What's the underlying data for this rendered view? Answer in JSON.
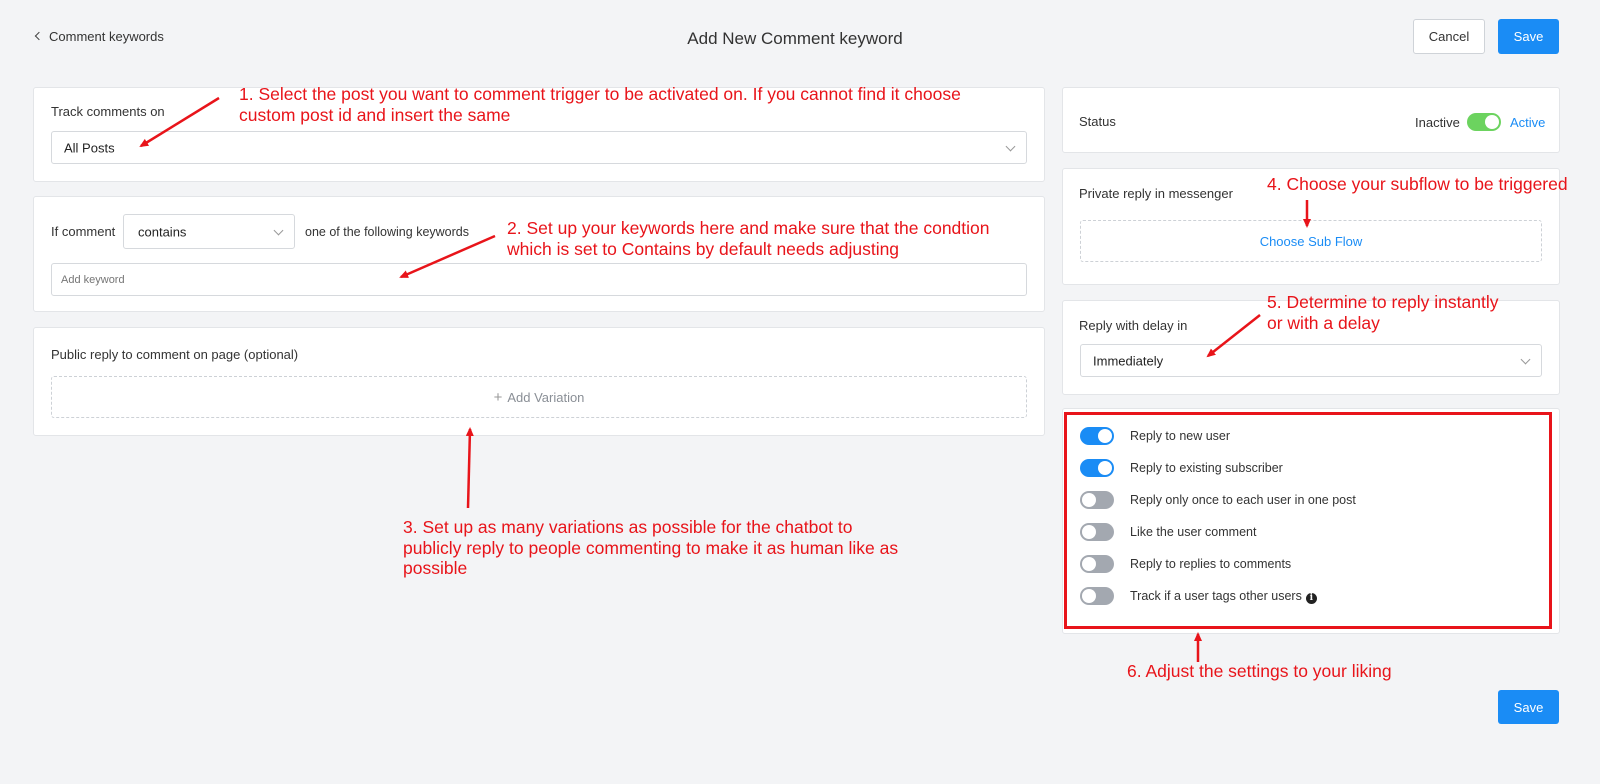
{
  "header": {
    "back_label": "Comment keywords",
    "title": "Add New Comment keyword",
    "cancel_label": "Cancel",
    "save_label": "Save"
  },
  "track": {
    "label": "Track comments on",
    "selected": "All Posts"
  },
  "keywords": {
    "if_label": "If comment",
    "condition": "contains",
    "suffix_label": "one of the following keywords",
    "placeholder": "Add keyword"
  },
  "public_reply": {
    "label": "Public reply to comment on page (optional)",
    "add_label": "Add Variation"
  },
  "status": {
    "label": "Status",
    "inactive_label": "Inactive",
    "active_label": "Active",
    "active": true
  },
  "private_reply": {
    "label": "Private reply in messenger",
    "choose_label": "Choose Sub Flow"
  },
  "delay": {
    "label": "Reply with delay in",
    "selected": "Immediately"
  },
  "options": [
    {
      "label": "Reply to new user",
      "on": true
    },
    {
      "label": "Reply to existing subscriber",
      "on": true
    },
    {
      "label": "Reply only once to each user in one post",
      "on": false
    },
    {
      "label": "Like the user comment",
      "on": false
    },
    {
      "label": "Reply to replies to comments",
      "on": false
    },
    {
      "label": "Track if a user tags other users",
      "on": false
    }
  ],
  "footer": {
    "save_label": "Save"
  },
  "annotations": {
    "n1_l1": "1. Select the post you want to comment trigger to be activated on. If you cannot find it choose",
    "n1_l2": "custom post id and insert the same",
    "n2_l1": "2. Set up your keywords here and make sure that the condtion",
    "n2_l2": "which is set to Contains by default needs adjusting",
    "n3_l1": "3. Set up as many variations as possible for the chatbot to",
    "n3_l2": "publicly reply to people commenting to make it as human like as",
    "n3_l3": "possible",
    "n4": "4. Choose your subflow to be triggered",
    "n5_l1": "5. Determine to reply instantly",
    "n5_l2": "or with a delay",
    "n6": "6. Adjust the settings to your liking"
  },
  "colors": {
    "primary": "#1a8cf5",
    "annotation_red": "#e8141a",
    "toggle_green": "#6cd35f",
    "toggle_off": "#a3a8b0"
  }
}
